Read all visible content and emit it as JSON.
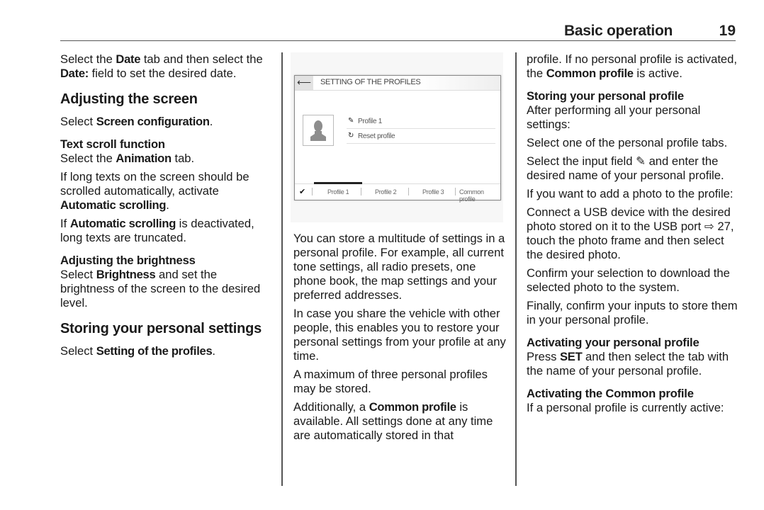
{
  "header": {
    "title": "Basic operation",
    "page_number": "19"
  },
  "column1": {
    "p1": {
      "t1": "Select the ",
      "b1": "Date",
      "t2": " tab and then select the ",
      "b2": "Date:",
      "t3": " field to set the desired date."
    },
    "h_adjusting_screen": "Adjusting the screen",
    "p2": {
      "t1": "Select ",
      "b1": "Screen configuration",
      "t2": "."
    },
    "h_text_scroll": "Text scroll function",
    "p3": {
      "t1": "Select the ",
      "b1": "Animation",
      "t2": " tab."
    },
    "p4": {
      "t1": "If long texts on the screen should be scrolled automatically, activate ",
      "b1": "Automatic scrolling",
      "t2": "."
    },
    "p5": {
      "t1": "If ",
      "b1": "Automatic scrolling",
      "t2": " is deactivated, long texts are truncated."
    },
    "h_brightness": "Adjusting the brightness",
    "p6": {
      "t1": "Select ",
      "b1": "Brightness",
      "t2": " and set the brightness of the screen to the desired level."
    },
    "h_storing_settings": "Storing your personal settings",
    "p7": {
      "t1": "Select ",
      "b1": "Setting of the profiles",
      "t2": "."
    }
  },
  "figure": {
    "back_icon": "arrow-left",
    "title": "SETTING OF THE PROFILES",
    "photo_icon": "person-silhouette",
    "rows": [
      {
        "icon": "pencil",
        "glyph": "✎",
        "label": "Profile 1"
      },
      {
        "icon": "reset",
        "glyph": "↻",
        "label": "Reset profile"
      }
    ],
    "check_icon": "✔",
    "tabs": [
      "Profile 1",
      "Profile 2",
      "Profile 3",
      "Common profile"
    ],
    "active_tab": "Profile 1"
  },
  "column2": {
    "p1": "You can store a multitude of settings in a personal profile. For example, all current tone settings, all radio presets, one phone book, the map settings and your preferred addresses.",
    "p2": "In case you share the vehicle with other people, this enables you to restore your personal settings from your profile at any time.",
    "p3": "A maximum of three personal profiles may be stored.",
    "p4": {
      "t1": "Additionally, a ",
      "b1": "Common profile",
      "t2": " is available. All settings done at any time are automatically stored in that"
    }
  },
  "column3": {
    "p1": {
      "t1": "profile. If no personal profile is activated, the ",
      "b1": "Common profile",
      "t2": " is active."
    },
    "h_storing_profile": "Storing your personal profile",
    "p2": "After performing all your personal settings:",
    "p3": "Select one of the personal profile tabs.",
    "p4": {
      "t1": "Select the input field ",
      "icon": "✎",
      "t2": " and enter the desired name of your personal profile."
    },
    "p5": "If you want to add a photo to the profile:",
    "p6": {
      "t1": "Connect a USB device with the desired photo stored on it to the USB port ",
      "ref_icon": "⇨",
      "ref": " 27",
      "t2": ", touch the photo frame and then select the desired photo."
    },
    "p7": "Confirm your selection to download the selected photo to the system.",
    "p8": "Finally, confirm your inputs to store them in your personal profile.",
    "h_activating_personal": "Activating your personal profile",
    "p9": {
      "t1": "Press ",
      "b1": "SET",
      "t2": " and then select the tab with the name of your personal profile."
    },
    "h_activating_common": "Activating the Common profile",
    "p10": "If a personal profile is currently active:"
  }
}
